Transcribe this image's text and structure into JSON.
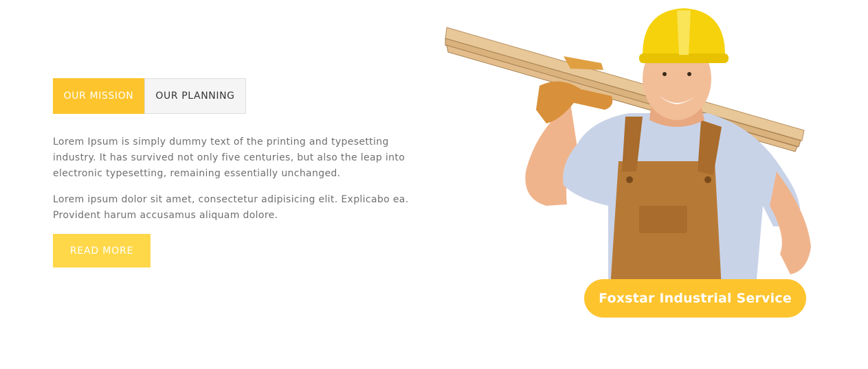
{
  "tabs": {
    "mission_label": "OUR MISSION",
    "planning_label": "OUR PLANNING"
  },
  "content": {
    "paragraph_1": "Lorem Ipsum is simply dummy text of the printing and typesetting industry. It has survived not only five centuries, but also the leap into electronic typesetting, remaining essentially unchanged.",
    "paragraph_2": "Lorem ipsum dolor sit amet, consectetur adipisicing elit. Explicabo ea. Provident harum accusamus aliquam dolore.",
    "read_more_label": "READ MORE"
  },
  "hero": {
    "image_subject": "worker-carrying-planks-icon",
    "badge_text": "Foxstar Industrial Service"
  },
  "colors": {
    "accent": "#fec42d",
    "button": "#ffd84a",
    "text": "#6f6f6f"
  }
}
